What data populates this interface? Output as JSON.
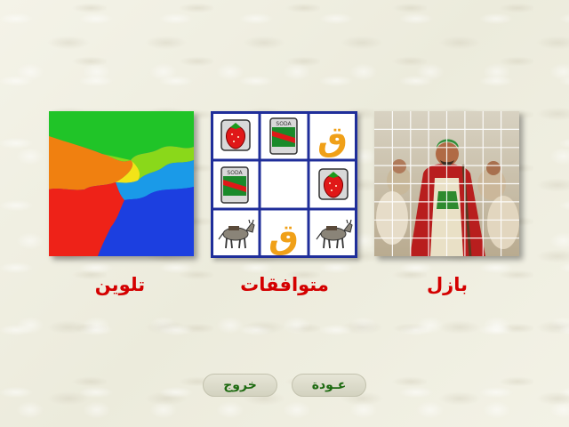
{
  "menu": {
    "items": [
      {
        "id": "coloring",
        "label": "تلوين"
      },
      {
        "id": "matching",
        "label": "متوافقات"
      },
      {
        "id": "puzzle",
        "label": "بازل"
      }
    ],
    "matching_grid": [
      [
        "strawberry-icon",
        "soda-can-icon",
        "qaf-letter"
      ],
      [
        "soda-can-icon",
        "empty-cell",
        "strawberry-icon"
      ],
      [
        "donkey-icon",
        "qaf-letter",
        "donkey-icon"
      ]
    ],
    "soda_text": "SODA",
    "qaf_letter": "ق"
  },
  "footer": {
    "exit_label": "خروج",
    "back_label": "عـودة"
  },
  "colors": {
    "label_red": "#d40000",
    "button_green": "#1d6a10",
    "grid_blue": "#1f2e9a",
    "qaf_orange": "#f0a018"
  }
}
